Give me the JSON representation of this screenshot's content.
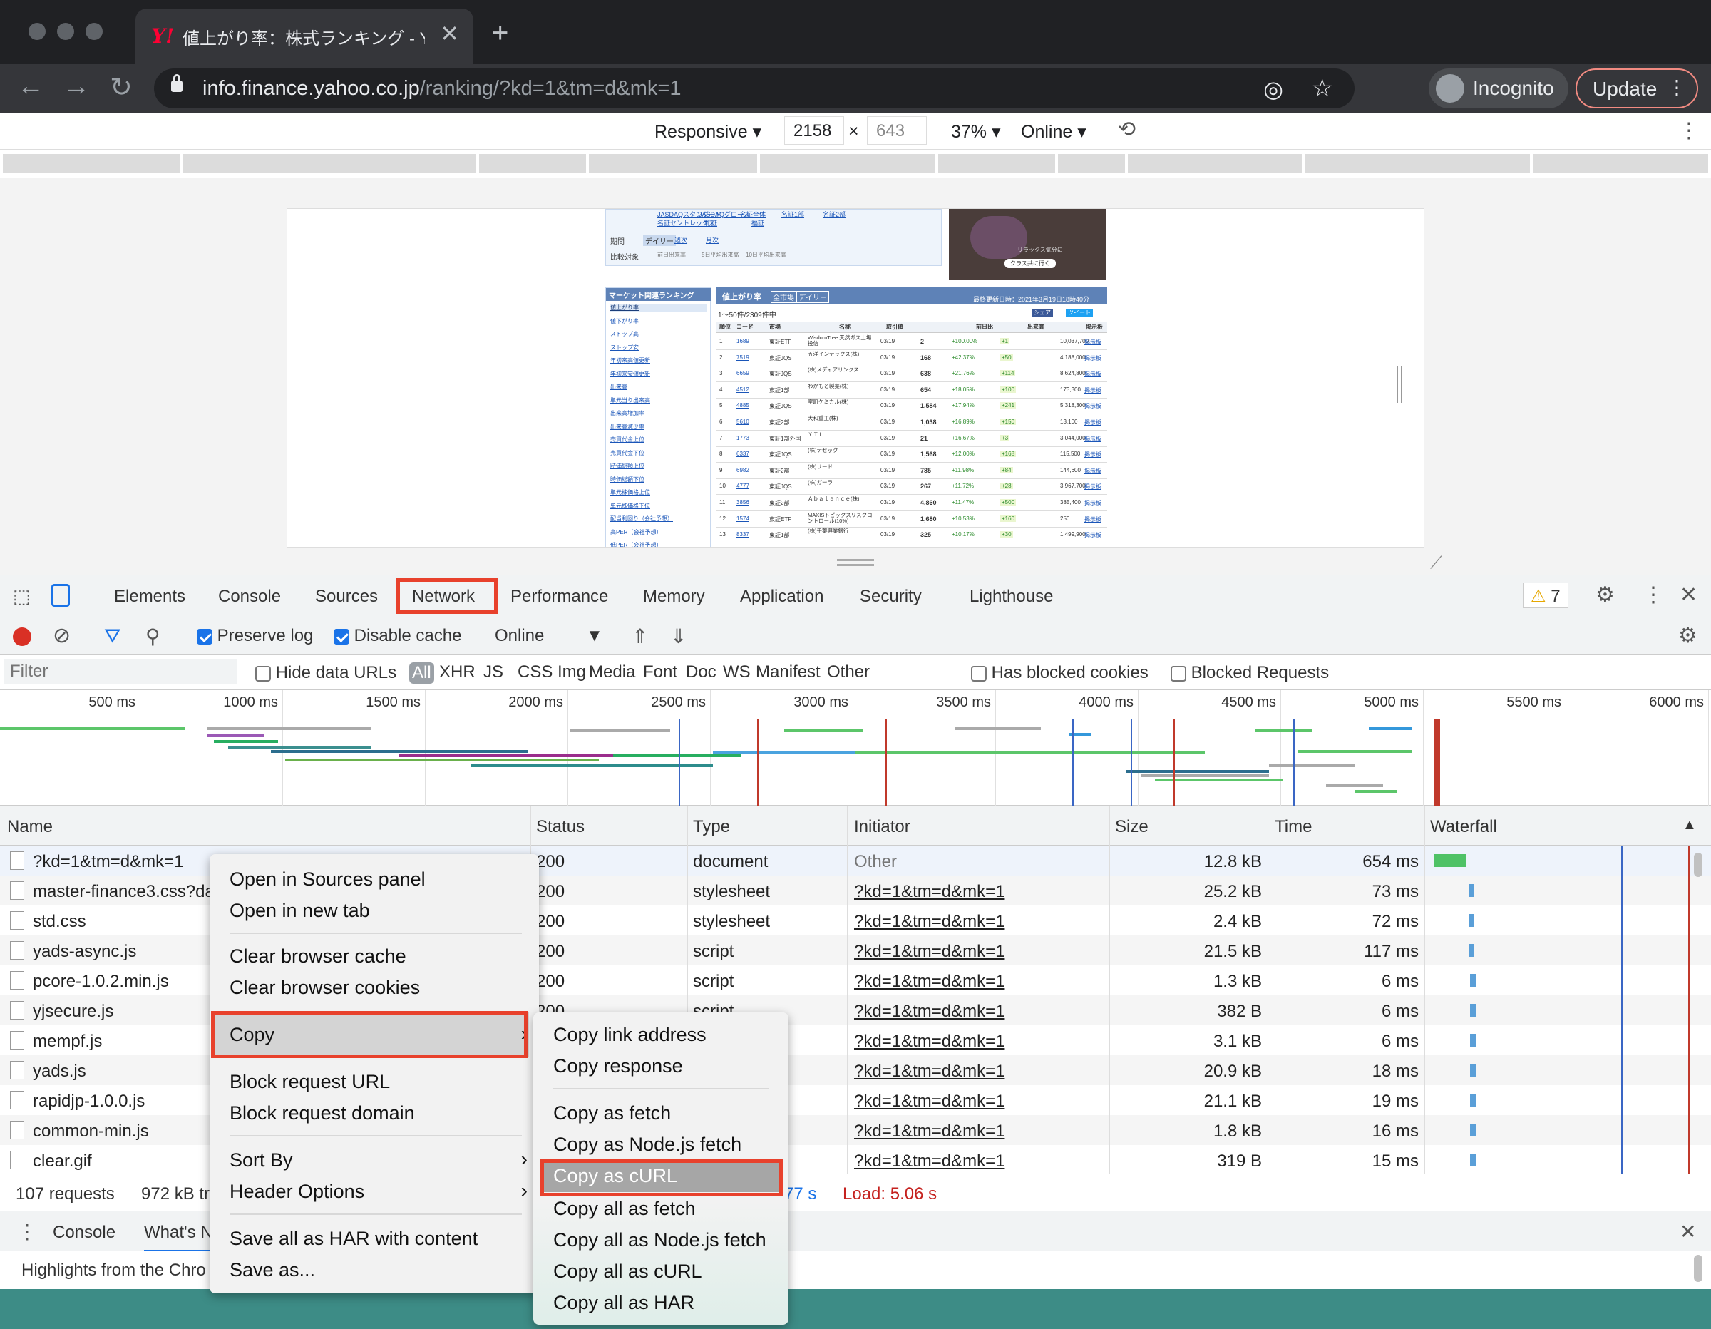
{
  "browser": {
    "tab_title": "値上がり率：株式ランキング - Yah",
    "url_host": "info.finance.yahoo.co.jp",
    "url_path": "/ranking/?kd=1&tm=d&mk=1",
    "incognito_label": "Incognito",
    "update_label": "Update"
  },
  "device_toolbar": {
    "mode": "Responsive ▾",
    "width": "2158",
    "times": "×",
    "height": "643",
    "zoom": "37% ▾",
    "throttle": "Online ▾"
  },
  "page": {
    "links_top": [
      "JASDAQスタンダード",
      "JASDAQグロース",
      "名証全体",
      "名証1部",
      "名証2部"
    ],
    "links_top2": [
      "名証セントレックス",
      "札証",
      "福証"
    ],
    "period_label": "期間",
    "period_opts": [
      "デイリー",
      "週次",
      "月次"
    ],
    "compare_label": "比較対象",
    "compare_opts": [
      "前日出来高",
      "5日平均出来高",
      "10日平均出来高"
    ],
    "ad_text": "リラックス気分に",
    "ad_button": "クラス共に行く",
    "side_title": "マーケット関連ランキング",
    "side_items": [
      "値上がり率",
      "値下がり率",
      "ストップ高",
      "ストップ安",
      "年初来高値更新",
      "年初来安値更新",
      "出来高",
      "単元当り出来高",
      "出来高増加率",
      "出来高減少率",
      "売買代金上位",
      "売買代金下位",
      "時価総額上位",
      "時価総額下位",
      "単元株価格上位",
      "単元株価格下位",
      "配当利回り（会社予想）",
      "高PER（会社予想）",
      "低PER（会社予想）"
    ],
    "main_title": "値上がり率",
    "main_badges": [
      "全市場",
      "デイリー"
    ],
    "updated": "最終更新日時：2021年3月19日18時40分",
    "count": "1〜50件/2309件中",
    "share": [
      "シェア",
      "ツイート"
    ],
    "headers": [
      "順位",
      "コード",
      "市場",
      "名称",
      "取引値",
      "前日比",
      "",
      "出来高",
      "掲示板"
    ],
    "rows": [
      [
        "1",
        "1689",
        "東証ETF",
        "WisdomTree 天然ガス上場投信",
        "03/19",
        "2",
        "+100.00%",
        "+1",
        "10,037,700",
        "掲示板"
      ],
      [
        "2",
        "7519",
        "東証JQS",
        "五洋インテックス(株)",
        "03/19",
        "168",
        "+42.37%",
        "+50",
        "4,188,000",
        "掲示板"
      ],
      [
        "3",
        "6659",
        "東証JQS",
        "(株)メディアリンクス",
        "03/19",
        "638",
        "+21.76%",
        "+114",
        "8,624,800",
        "掲示板"
      ],
      [
        "4",
        "4512",
        "東証1部",
        "わかもと製薬(株)",
        "03/19",
        "654",
        "+18.05%",
        "+100",
        "173,300",
        "掲示板"
      ],
      [
        "5",
        "4885",
        "東証JQS",
        "室町ケミカル(株)",
        "03/19",
        "1,584",
        "+17.94%",
        "+241",
        "5,318,300",
        "掲示板"
      ],
      [
        "6",
        "5610",
        "東証2部",
        "大和重工(株)",
        "03/19",
        "1,038",
        "+16.89%",
        "+150",
        "13,100",
        "掲示板"
      ],
      [
        "7",
        "1773",
        "東証1部外国",
        "ＹＴＬ",
        "03/19",
        "21",
        "+16.67%",
        "+3",
        "3,044,000",
        "掲示板"
      ],
      [
        "8",
        "6337",
        "東証JQS",
        "(株)テセック",
        "03/19",
        "1,568",
        "+12.00%",
        "+168",
        "115,500",
        "掲示板"
      ],
      [
        "9",
        "6982",
        "東証2部",
        "(株)リード",
        "03/19",
        "785",
        "+11.98%",
        "+84",
        "144,600",
        "掲示板"
      ],
      [
        "10",
        "4777",
        "東証JQS",
        "(株)ガーラ",
        "03/19",
        "267",
        "+11.72%",
        "+28",
        "3,967,700",
        "掲示板"
      ],
      [
        "11",
        "3856",
        "東証2部",
        "Ａｂａｌａｎｃｅ(株)",
        "03/19",
        "4,860",
        "+11.47%",
        "+500",
        "385,400",
        "掲示板"
      ],
      [
        "12",
        "1574",
        "東証ETF",
        "MAXISトピックスリスクコントロール(10%)",
        "03/19",
        "1,680",
        "+10.53%",
        "+160",
        "250",
        "掲示板"
      ],
      [
        "13",
        "8337",
        "東証1部",
        "(株)千葉興業銀行",
        "03/19",
        "325",
        "+10.17%",
        "+30",
        "1,499,900",
        "掲示板"
      ]
    ]
  },
  "devtools": {
    "tabs": [
      "Elements",
      "Console",
      "Sources",
      "Network",
      "Performance",
      "Memory",
      "Application",
      "Security",
      "Lighthouse"
    ],
    "warn_count": "7",
    "preserve_log": "Preserve log",
    "disable_cache": "Disable cache",
    "throttle": "Online",
    "filter_placeholder": "Filter",
    "hide_data_urls": "Hide data URLs",
    "types": [
      "All",
      "XHR",
      "JS",
      "CSS",
      "Img",
      "Media",
      "Font",
      "Doc",
      "WS",
      "Manifest",
      "Other"
    ],
    "has_blocked": "Has blocked cookies",
    "blocked_requests": "Blocked Requests",
    "ticks": [
      "500 ms",
      "1000 ms",
      "1500 ms",
      "2000 ms",
      "2500 ms",
      "3000 ms",
      "3500 ms",
      "4000 ms",
      "4500 ms",
      "5000 ms",
      "5500 ms",
      "6000 ms"
    ],
    "columns": [
      "Name",
      "Status",
      "Type",
      "Initiator",
      "Size",
      "Time",
      "Waterfall"
    ],
    "requests": [
      {
        "name": "?kd=1&tm=d&mk=1",
        "status": "200",
        "type": "document",
        "initiator": "Other",
        "size": "12.8 kB",
        "time": "654 ms"
      },
      {
        "name": "master-finance3.css?da",
        "status": "200",
        "type": "stylesheet",
        "initiator": "?kd=1&tm=d&mk=1",
        "size": "25.2 kB",
        "time": "73 ms"
      },
      {
        "name": "std.css",
        "status": "200",
        "type": "stylesheet",
        "initiator": "?kd=1&tm=d&mk=1",
        "size": "2.4 kB",
        "time": "72 ms"
      },
      {
        "name": "yads-async.js",
        "status": "200",
        "type": "script",
        "initiator": "?kd=1&tm=d&mk=1",
        "size": "21.5 kB",
        "time": "117 ms"
      },
      {
        "name": "pcore-1.0.2.min.js",
        "status": "200",
        "type": "script",
        "initiator": "?kd=1&tm=d&mk=1",
        "size": "1.3 kB",
        "time": "6 ms"
      },
      {
        "name": "yjsecure.js",
        "status": "200",
        "type": "script",
        "initiator": "?kd=1&tm=d&mk=1",
        "size": "382 B",
        "time": "6 ms"
      },
      {
        "name": "mempf.js",
        "status": "",
        "type": "",
        "initiator": "?kd=1&tm=d&mk=1",
        "size": "3.1 kB",
        "time": "6 ms"
      },
      {
        "name": "yads.js",
        "status": "",
        "type": "",
        "initiator": "?kd=1&tm=d&mk=1",
        "size": "20.9 kB",
        "time": "18 ms"
      },
      {
        "name": "rapidjp-1.0.0.js",
        "status": "",
        "type": "",
        "initiator": "?kd=1&tm=d&mk=1",
        "size": "21.1 kB",
        "time": "19 ms"
      },
      {
        "name": "common-min.js",
        "status": "",
        "type": "",
        "initiator": "?kd=1&tm=d&mk=1",
        "size": "1.8 kB",
        "time": "16 ms"
      },
      {
        "name": "clear.gif",
        "status": "",
        "type": "",
        "initiator": "?kd=1&tm=d&mk=1",
        "size": "319 B",
        "time": "15 ms"
      }
    ],
    "summary_requests": "107 requests",
    "summary_transferred": "972 kB tr",
    "summary_partial": "77 s",
    "summary_load": "Load: 5.06 s",
    "drawer_tabs": [
      "Console",
      "What's N"
    ],
    "drawer_text": "Highlights from the Chro"
  },
  "context_menu": {
    "items": [
      "Open in Sources panel",
      "Open in new tab",
      "Clear browser cache",
      "Clear browser cookies",
      "Copy",
      "Block request URL",
      "Block request domain",
      "Sort By",
      "Header Options",
      "Save all as HAR with content",
      "Save as..."
    ]
  },
  "copy_submenu": {
    "items": [
      "Copy link address",
      "Copy response",
      "Copy as fetch",
      "Copy as Node.js fetch",
      "Copy as cURL",
      "Copy all as fetch",
      "Copy all as Node.js fetch",
      "Copy all as cURL",
      "Copy all as HAR"
    ]
  }
}
